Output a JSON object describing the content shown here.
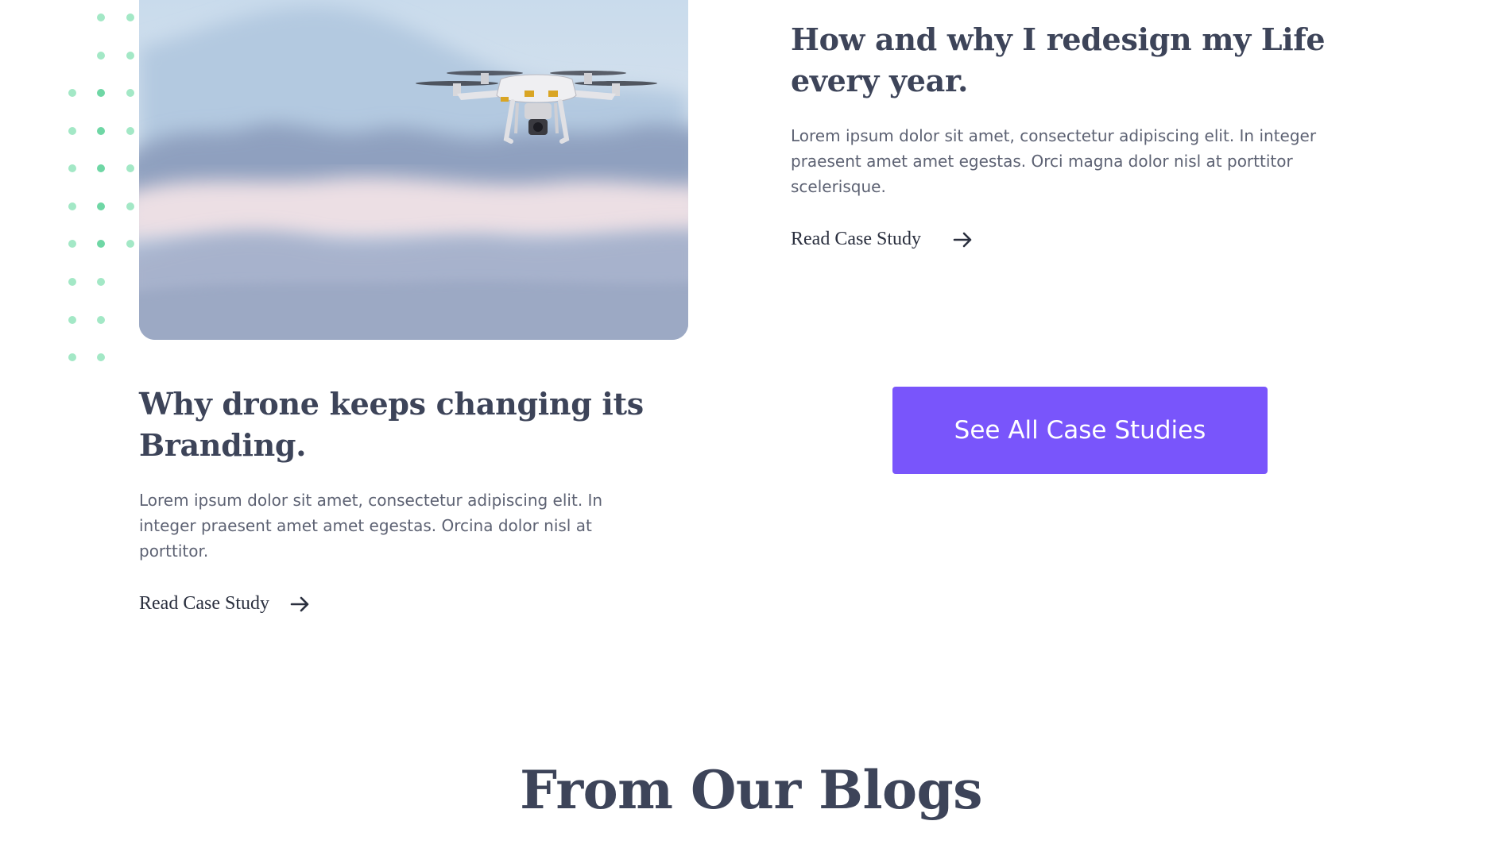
{
  "case_studies": [
    {
      "title": "How and why I redesign my Life every year.",
      "description": "Lorem ipsum dolor sit amet, consectetur adipiscing elit. In integer praesent amet amet egestas. Orci magna dolor nisl at porttitor scelerisque.",
      "link_label": "Read Case Study",
      "link_icon": "arrow-right-icon"
    },
    {
      "title": "Why drone keeps changing its Branding.",
      "description": "Lorem ipsum dolor sit amet, consectetur adipiscing elit. In integer praesent amet amet egestas. Orcina dolor nisl at porttitor.",
      "link_label": "Read Case Study",
      "link_icon": "arrow-right-icon"
    }
  ],
  "cta": {
    "label": "See All Case Studies"
  },
  "blogs": {
    "heading": "From Our Blogs"
  },
  "colors": {
    "accent": "#7955fb",
    "heading": "#3d4459",
    "body_text": "#5d6273",
    "link_text": "#2a2f3e",
    "dot_light": "#a3e8c6",
    "dot_strong": "#6fd7a5"
  }
}
